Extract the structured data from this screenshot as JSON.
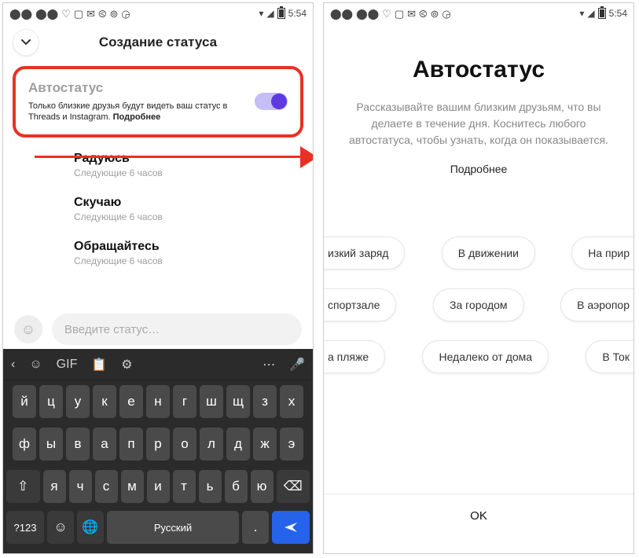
{
  "statusbar": {
    "time": "5:54"
  },
  "left": {
    "title": "Создание статуса",
    "card": {
      "title": "Автостатус",
      "desc_prefix": "Только близкие друзья будут видеть ваш статус в Threads и Instagram. ",
      "desc_more": "Подробнее"
    },
    "options": [
      {
        "title": "Радуюсь",
        "sub": "Следующие 6 часов"
      },
      {
        "title": "Скучаю",
        "sub": "Следующие 6 часов"
      },
      {
        "title": "Обращайтесь",
        "sub": "Следующие 6 часов"
      }
    ],
    "composer_placeholder": "Введите статус…",
    "keyboard": {
      "gif": "GIF",
      "row1": [
        "й",
        "ц",
        "у",
        "к",
        "е",
        "н",
        "г",
        "ш",
        "щ",
        "з",
        "х"
      ],
      "row2": [
        "ф",
        "ы",
        "в",
        "а",
        "п",
        "р",
        "о",
        "л",
        "д",
        "ж",
        "э"
      ],
      "row3": [
        "я",
        "ч",
        "с",
        "м",
        "и",
        "т",
        "ь",
        "б",
        "ю"
      ],
      "sym": "?123",
      "space": "Русский",
      "dot": "."
    }
  },
  "right": {
    "title": "Автостатус",
    "sub": "Рассказывайте вашим близким друзьям, что вы делаете в течение дня. Коснитесь любого автостатуса, чтобы узнать, когда он показывается.",
    "more": "Подробнее",
    "chips": [
      [
        "изкий заряд",
        "В движении",
        "На прир"
      ],
      [
        "спортзале",
        "За городом",
        "В аэропор"
      ],
      [
        "а пляже",
        "Недалеко от дома",
        "В Ток"
      ]
    ],
    "ok": "OK"
  }
}
